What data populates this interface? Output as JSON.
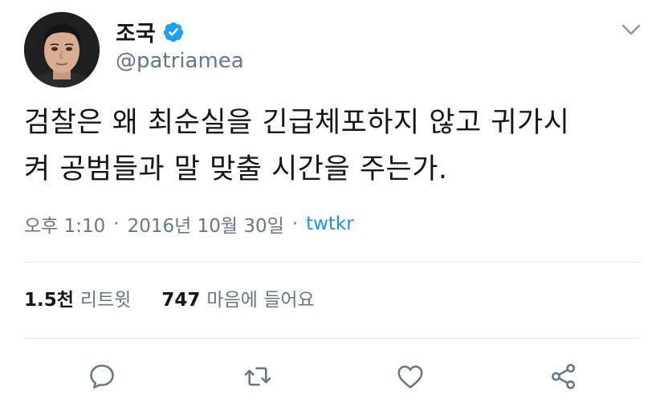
{
  "user": {
    "display_name": "조국",
    "handle": "@patriamea",
    "verified": true,
    "avatar_icon": "profile-photo"
  },
  "tweet": {
    "text_line1": "검찰은 왜 최순실을 긴급체포하지 않고 귀가시",
    "text_line2": "켜 공범들과 말 맞출 시간을 주는가."
  },
  "meta": {
    "time": "오후 1:10",
    "separator1": "·",
    "date": "2016년 10월 30일",
    "separator2": "·",
    "source": "twtkr"
  },
  "stats": {
    "retweets_count": "1.5천",
    "retweets_label": "리트윗",
    "likes_count": "747",
    "likes_label": "마음에 들어요"
  },
  "actions": {
    "reply_icon": "reply-icon",
    "retweet_icon": "retweet-icon",
    "like_icon": "heart-icon",
    "share_icon": "share-icon"
  },
  "colors": {
    "accent": "#1da1f2",
    "link": "#1b95e0",
    "muted": "#657786",
    "text": "#14171a",
    "divider": "#e1e8ed"
  }
}
